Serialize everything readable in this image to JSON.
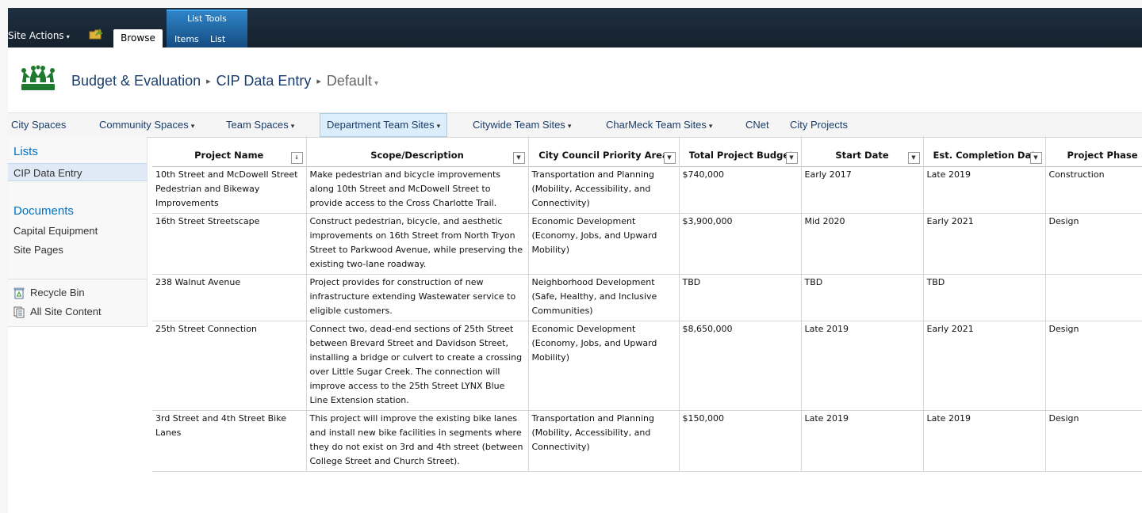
{
  "ribbon": {
    "site_actions": "Site Actions",
    "site_actions_caret": "▾",
    "tab_browse": "Browse",
    "list_tools": {
      "caption": "List Tools",
      "tab_items": "Items",
      "tab_list": "List"
    }
  },
  "breadcrumb": {
    "site": "Budget & Evaluation",
    "list": "CIP Data Entry",
    "view": "Default",
    "separator": "▸",
    "view_dropdown": "▾"
  },
  "top_nav": {
    "dropdown_glyph": "▾",
    "items": [
      {
        "label": "City Spaces"
      },
      {
        "label": "Community Spaces"
      },
      {
        "label": "Team Spaces"
      },
      {
        "label": "Department Team Sites"
      },
      {
        "label": "Citywide Team Sites"
      },
      {
        "label": "CharMeck Team Sites"
      },
      {
        "label": "CNet"
      },
      {
        "label": "City Projects"
      }
    ]
  },
  "quick_launch": {
    "lists_heading": "Lists",
    "lists": [
      "CIP Data Entry"
    ],
    "documents_heading": "Documents",
    "documents": [
      "Capital Equipment",
      "Site Pages"
    ],
    "recycle_bin": "Recycle Bin",
    "all_site_content": "All Site Content"
  },
  "grid": {
    "columns": [
      "Project Name",
      "Scope/Description",
      "City Council Priority Area",
      "Total Project Budget",
      "Start Date",
      "Est. Completion Date",
      "Project Phase"
    ],
    "rows": [
      [
        "10th Street and McDowell Street Pedestrian and Bikeway Improvements",
        "Make pedestrian and bicycle improvements along 10th Street and McDowell Street to provide access to the Cross Charlotte Trail.",
        "Transportation and Planning (Mobility, Accessibility, and Connectivity)",
        "$740,000",
        "Early 2017",
        "Late 2019",
        "Construction"
      ],
      [
        "16th Street Streetscape",
        "Construct pedestrian, bicycle, and aesthetic improvements on 16th Street from North Tryon Street to Parkwood Avenue, while preserving the existing two-lane roadway.",
        "Economic Development (Economy, Jobs, and Upward Mobility)",
        "$3,900,000",
        "Mid 2020",
        "Early 2021",
        "Design"
      ],
      [
        "238 Walnut Avenue",
        "Project provides for construction of new infrastructure extending Wastewater service to eligible customers.",
        "Neighborhood Development (Safe, Healthy, and Inclusive Communities)",
        "TBD",
        "TBD",
        "TBD",
        ""
      ],
      [
        "25th Street Connection",
        "Connect two, dead-end sections of 25th Street between Brevard Street and Davidson Street, installing a bridge or culvert to create a crossing over Little Sugar Creek. The connection will improve access to the 25th Street LYNX Blue Line Extension station.",
        "Economic Development (Economy, Jobs, and Upward Mobility)",
        "$8,650,000",
        "Late 2019",
        "Early 2021",
        "Design"
      ],
      [
        "3rd Street and 4th Street Bike Lanes",
        "This project will improve the existing bike lanes and install new bike facilities in segments where they do not exist on 3rd and 4th street (between College Street and Church Street).",
        "Transportation and Planning (Mobility, Accessibility, and Connectivity)",
        "$150,000",
        "Late 2019",
        "Late 2019",
        "Design"
      ]
    ]
  }
}
